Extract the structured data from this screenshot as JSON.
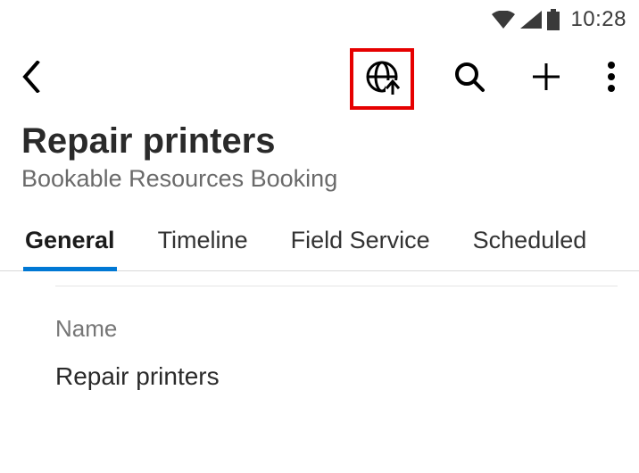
{
  "status": {
    "time": "10:28"
  },
  "header": {
    "title": "Repair printers",
    "subtitle": "Bookable Resources Booking"
  },
  "tabs": [
    {
      "label": "General",
      "active": true
    },
    {
      "label": "Timeline",
      "active": false
    },
    {
      "label": "Field Service",
      "active": false
    },
    {
      "label": "Scheduled",
      "active": false
    }
  ],
  "form": {
    "name": {
      "label": "Name",
      "value": "Repair printers"
    }
  },
  "icons": {
    "back": "back-chevron",
    "globe_upload": "globe-upload",
    "search": "search",
    "add": "plus",
    "overflow": "kebab-menu",
    "wifi": "wifi",
    "signal": "cell-signal",
    "battery": "battery-full"
  }
}
